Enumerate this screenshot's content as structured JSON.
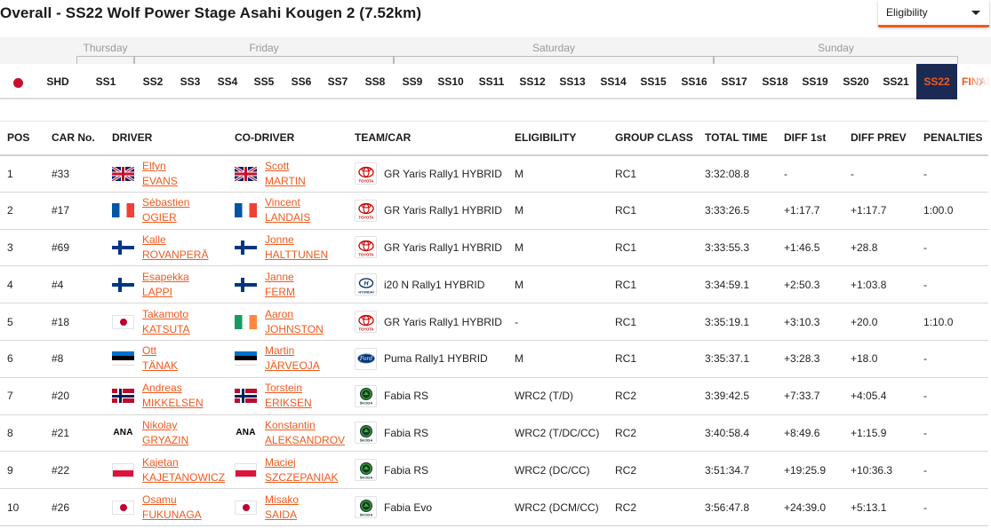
{
  "header": {
    "title": "Overall - SS22 Wolf Power Stage Asahi Kougen 2 (7.52km)",
    "eligibility_label": "Eligibility"
  },
  "days": [
    "Thursday",
    "Friday",
    "Saturday",
    "Sunday"
  ],
  "stages": [
    "SHD",
    "SS1",
    "SS2",
    "SS3",
    "SS4",
    "SS5",
    "SS6",
    "SS7",
    "SS8",
    "SS9",
    "SS10",
    "SS11",
    "SS12",
    "SS13",
    "SS14",
    "SS15",
    "SS16",
    "SS17",
    "SS18",
    "SS19",
    "SS20",
    "SS21",
    "SS22",
    "FINAL"
  ],
  "active_stage": "SS22",
  "colors": {
    "accent": "#f05a1e",
    "active_bg": "#1b2a52"
  },
  "columns": [
    "POS",
    "CAR No.",
    "DRIVER",
    "CO-DRIVER",
    "TEAM/CAR",
    "ELIGIBILITY",
    "GROUP CLASS",
    "TOTAL TIME",
    "DIFF 1st",
    "DIFF PREV",
    "PENALTIES"
  ],
  "rows": [
    {
      "pos": "1",
      "car": "#33",
      "driver_flag": "gb",
      "driver_first": "Elfyn",
      "driver_last": "EVANS",
      "codriver_flag": "gb",
      "codriver_first": "Scott",
      "codriver_last": "MARTIN",
      "logo": "toyota-logo",
      "logo_text": "TOYOTA",
      "team": "GR Yaris Rally1 HYBRID",
      "eligibility": "M",
      "group": "RC1",
      "total": "3:32:08.8",
      "diff1": "-",
      "diffprev": "-",
      "penalties": "-"
    },
    {
      "pos": "2",
      "car": "#17",
      "driver_flag": "fr",
      "driver_first": "Sébastien",
      "driver_last": "OGIER",
      "codriver_flag": "fr",
      "codriver_first": "Vincent",
      "codriver_last": "LANDAIS",
      "logo": "toyota-logo",
      "logo_text": "TOYOTA",
      "team": "GR Yaris Rally1 HYBRID",
      "eligibility": "M",
      "group": "RC1",
      "total": "3:33:26.5",
      "diff1": "+1:17.7",
      "diffprev": "+1:17.7",
      "penalties": "1:00.0"
    },
    {
      "pos": "3",
      "car": "#69",
      "driver_flag": "fi",
      "driver_first": "Kalle",
      "driver_last": "ROVANPERÄ",
      "codriver_flag": "fi",
      "codriver_first": "Jonne",
      "codriver_last": "HALTTUNEN",
      "logo": "toyota-logo",
      "logo_text": "TOYOTA",
      "team": "GR Yaris Rally1 HYBRID",
      "eligibility": "M",
      "group": "RC1",
      "total": "3:33:55.3",
      "diff1": "+1:46.5",
      "diffprev": "+28.8",
      "penalties": "-"
    },
    {
      "pos": "4",
      "car": "#4",
      "driver_flag": "fi",
      "driver_first": "Esapekka",
      "driver_last": "LAPPI",
      "codriver_flag": "fi",
      "codriver_first": "Janne",
      "codriver_last": "FERM",
      "logo": "hyundai-logo",
      "logo_text": "HYUNDAI",
      "team": "i20 N Rally1 HYBRID",
      "eligibility": "M",
      "group": "RC1",
      "total": "3:34:59.1",
      "diff1": "+2:50.3",
      "diffprev": "+1:03.8",
      "penalties": "-"
    },
    {
      "pos": "5",
      "car": "#18",
      "driver_flag": "jp",
      "driver_first": "Takamoto",
      "driver_last": "KATSUTA",
      "codriver_flag": "ie",
      "codriver_first": "Aaron",
      "codriver_last": "JOHNSTON",
      "logo": "toyota-logo",
      "logo_text": "TOYOTA",
      "team": "GR Yaris Rally1 HYBRID",
      "eligibility": "-",
      "group": "RC1",
      "total": "3:35:19.1",
      "diff1": "+3:10.3",
      "diffprev": "+20.0",
      "penalties": "1:10.0"
    },
    {
      "pos": "6",
      "car": "#8",
      "driver_flag": "ee",
      "driver_first": "Ott",
      "driver_last": "TÄNAK",
      "codriver_flag": "ee",
      "codriver_first": "Martin",
      "codriver_last": "JÄRVEOJA",
      "logo": "ford-logo",
      "logo_text": "Ford",
      "team": "Puma Rally1 HYBRID",
      "eligibility": "M",
      "group": "RC1",
      "total": "3:35:37.1",
      "diff1": "+3:28.3",
      "diffprev": "+18.0",
      "penalties": "-"
    },
    {
      "pos": "7",
      "car": "#20",
      "driver_flag": "no",
      "driver_first": "Andreas",
      "driver_last": "MIKKELSEN",
      "codriver_flag": "no",
      "codriver_first": "Torstein",
      "codriver_last": "ERIKSEN",
      "logo": "skoda-logo",
      "logo_text": "ŠKODA",
      "team": "Fabia RS",
      "eligibility": "WRC2 (T/D)",
      "group": "RC2",
      "total": "3:39:42.5",
      "diff1": "+7:33.7",
      "diffprev": "+4:05.4",
      "penalties": "-"
    },
    {
      "pos": "8",
      "car": "#21",
      "driver_flag": "ana",
      "driver_first": "Nikolay",
      "driver_last": "GRYAZIN",
      "codriver_flag": "ana",
      "codriver_first": "Konstantin",
      "codriver_last": "ALEKSANDROV",
      "logo": "skoda-logo",
      "logo_text": "ŠKODA",
      "team": "Fabia RS",
      "eligibility": "WRC2 (T/DC/CC)",
      "group": "RC2",
      "total": "3:40:58.4",
      "diff1": "+8:49.6",
      "diffprev": "+1:15.9",
      "penalties": "-"
    },
    {
      "pos": "9",
      "car": "#22",
      "driver_flag": "pl",
      "driver_first": "Kajetan",
      "driver_last": "KAJETANOWICZ",
      "codriver_flag": "pl",
      "codriver_first": "Maciej",
      "codriver_last": "SZCZEPANIAK",
      "logo": "skoda-logo",
      "logo_text": "ŠKODA",
      "team": "Fabia RS",
      "eligibility": "WRC2 (DC/CC)",
      "group": "RC2",
      "total": "3:51:34.7",
      "diff1": "+19:25.9",
      "diffprev": "+10:36.3",
      "penalties": "-"
    },
    {
      "pos": "10",
      "car": "#26",
      "driver_flag": "jp",
      "driver_first": "Osamu",
      "driver_last": "FUKUNAGA",
      "codriver_flag": "jp",
      "codriver_first": "Misako",
      "codriver_last": "SAIDA",
      "logo": "skoda-logo",
      "logo_text": "ŠKODA",
      "team": "Fabia Evo",
      "eligibility": "WRC2 (DCM/CC)",
      "group": "RC2",
      "total": "3:56:47.8",
      "diff1": "+24:39.0",
      "diffprev": "+5:13.1",
      "penalties": "-"
    }
  ]
}
